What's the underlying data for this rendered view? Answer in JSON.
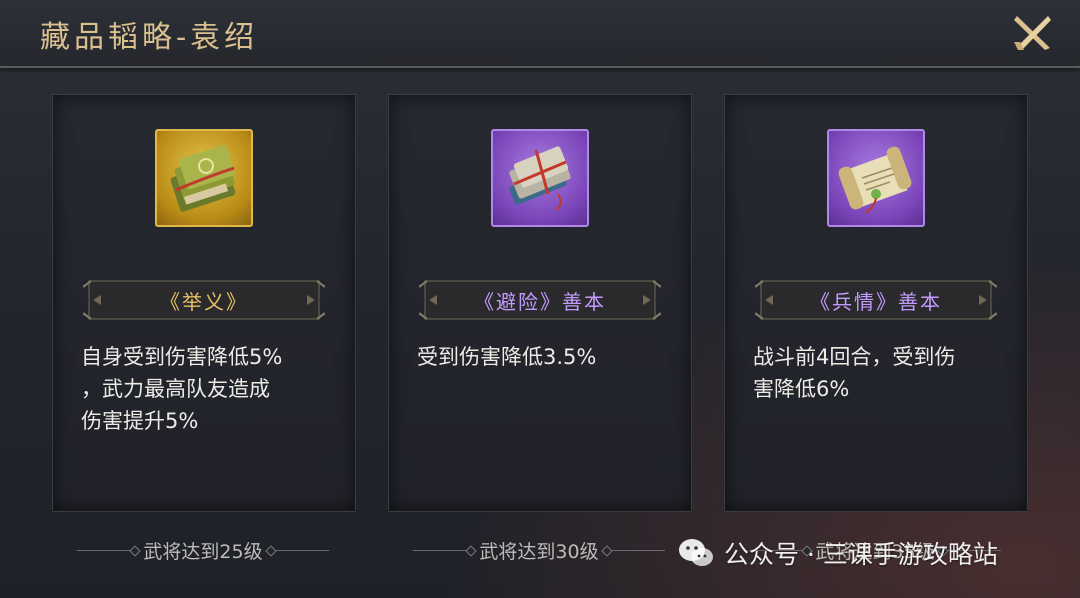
{
  "header": {
    "title": "藏品韬略-袁绍",
    "close_icon": "close-x-icon"
  },
  "cards": [
    {
      "icon": "green-book-bundle-icon",
      "rarity_color": "#d4a838",
      "name": "《举义》",
      "description": "自身受到伤害降低5%\n，武力最高队友造成\n伤害提升5%",
      "requirement": "武将达到25级"
    },
    {
      "icon": "grey-book-bundle-icon",
      "rarity_color": "#8a55c8",
      "name": "《避险》善本",
      "description": "受到伤害降低3.5%",
      "requirement": "武将达到30级"
    },
    {
      "icon": "scroll-icon",
      "rarity_color": "#8a55c8",
      "name": "《兵情》善本",
      "description": "战斗前4回合，受到伤\n害降低6%",
      "requirement": "武将达到35级"
    }
  ],
  "watermark": {
    "icon": "wechat-icon",
    "text": "公众号 · 三课手游攻略站"
  }
}
